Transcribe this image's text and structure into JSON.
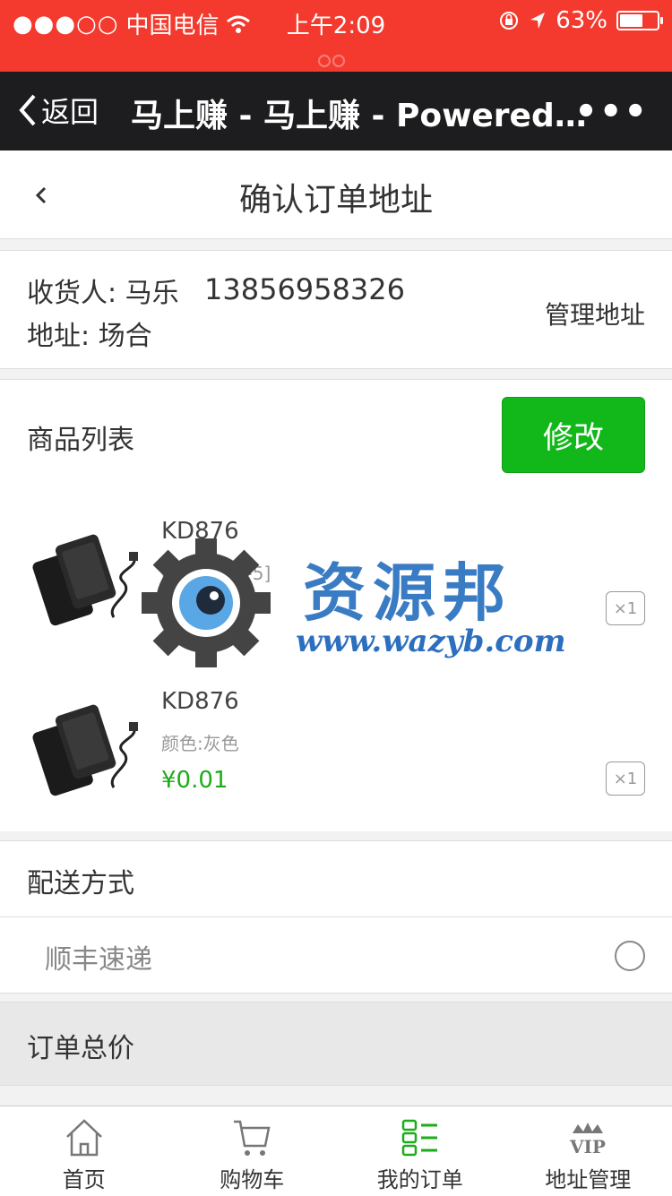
{
  "status_bar": {
    "signal": "●●●○○",
    "carrier": "中国电信",
    "time": "上午2:09",
    "battery": "63%",
    "battery_level": 0.63
  },
  "nav": {
    "back_label": "返回",
    "title": "马上赚 - 马上赚 - Powered b...",
    "more": "•••"
  },
  "page": {
    "title": "确认订单地址"
  },
  "address": {
    "recipient": "收货人: 马乐",
    "phone": "13856958326",
    "address": "地址: 场合",
    "manage_label": "管理地址"
  },
  "goods": {
    "header": "商品列表",
    "edit_label": "修改",
    "items": [
      {
        "name": "KD876",
        "spec": "颜色:[白色-5]",
        "price": "¥0.01",
        "qty": "×1"
      },
      {
        "name": "KD876",
        "spec": "颜色:灰色",
        "price": "¥0.01",
        "qty": "×1"
      }
    ]
  },
  "watermark": {
    "title": "资源邦",
    "url": "www.wazyb.com"
  },
  "delivery": {
    "header": "配送方式",
    "option": "顺丰速递"
  },
  "order_total": {
    "label": "订单总价"
  },
  "tabbar": [
    {
      "label": "首页",
      "icon": "home-icon"
    },
    {
      "label": "购物车",
      "icon": "cart-icon"
    },
    {
      "label": "我的订单",
      "icon": "orders-icon",
      "color": "#1aad19"
    },
    {
      "label": "地址管理",
      "icon": "vip-icon"
    }
  ]
}
